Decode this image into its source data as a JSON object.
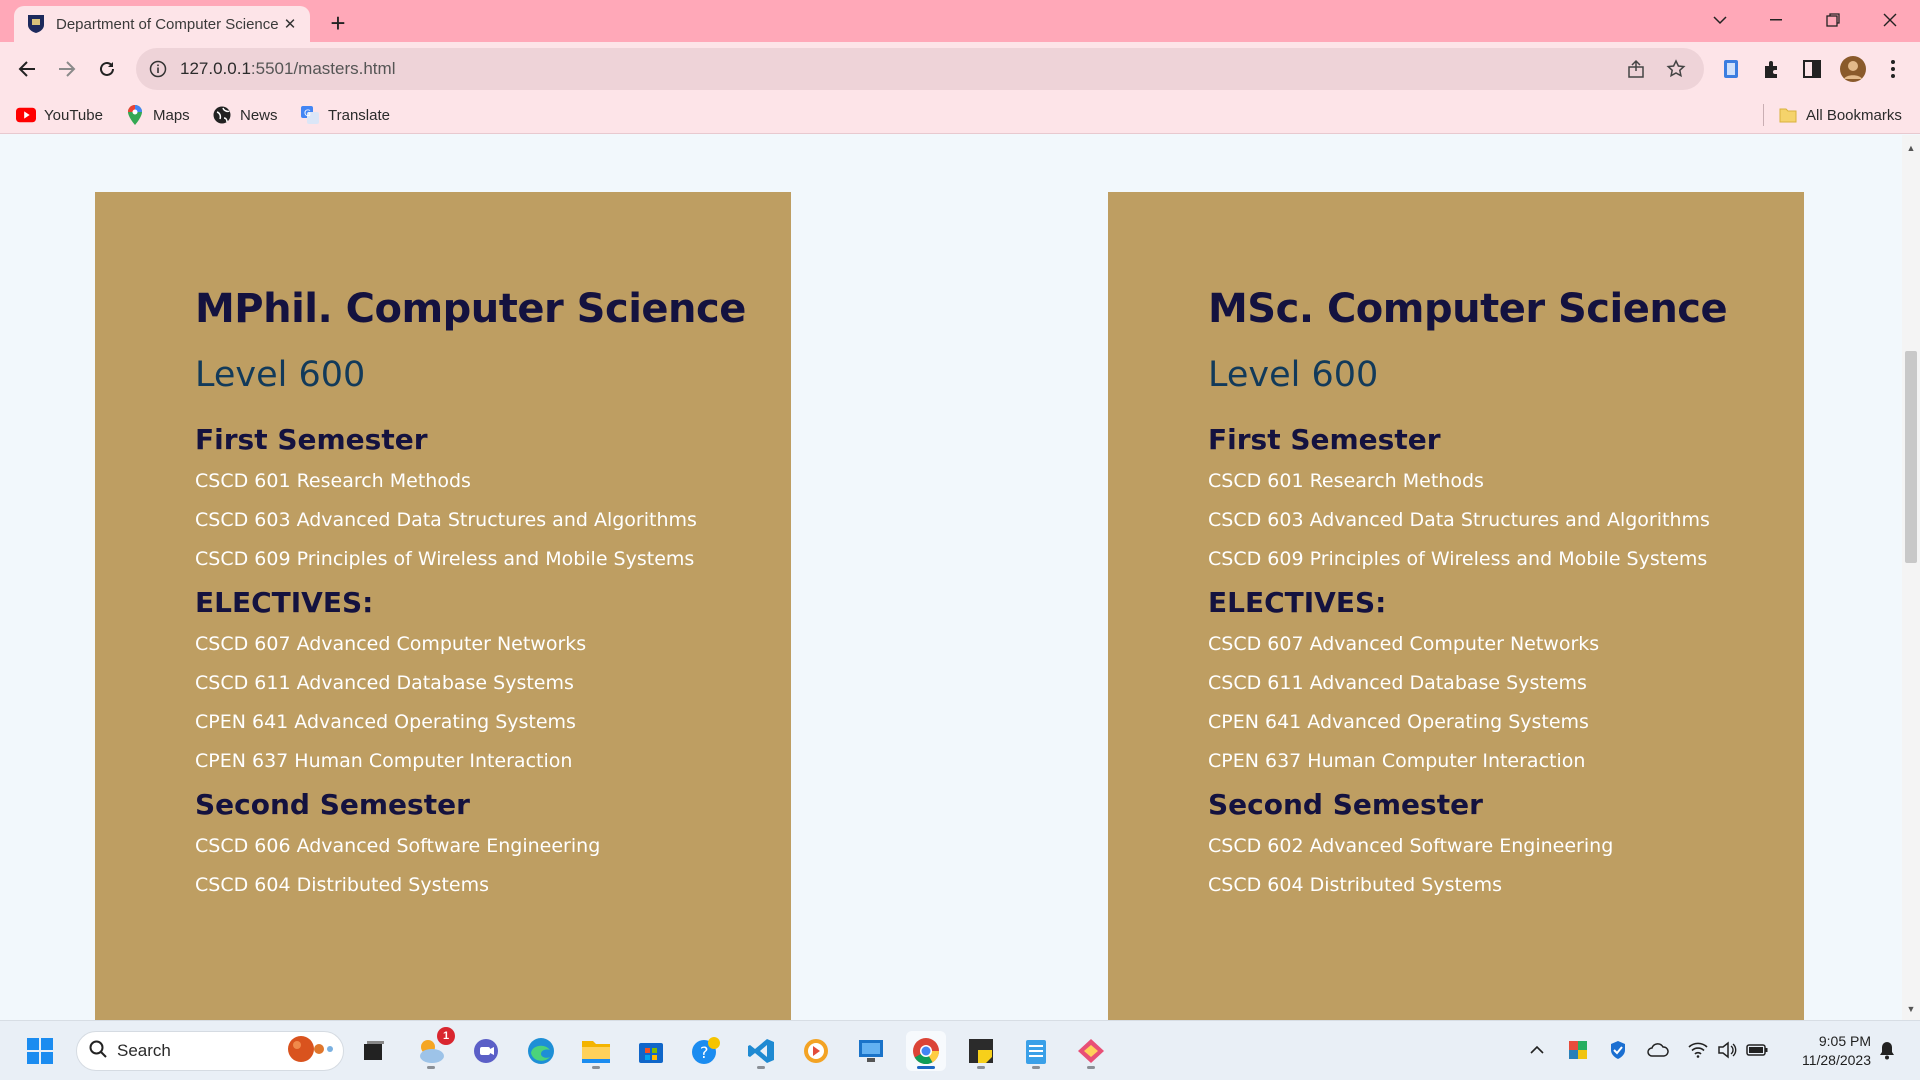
{
  "browser": {
    "tab_title": "Department of Computer Science",
    "url_host": "127.0.0.1",
    "url_rest": ":5501/masters.html",
    "bookmarks": [
      {
        "label": "YouTube",
        "icon": "youtube-icon"
      },
      {
        "label": "Maps",
        "icon": "maps-icon"
      },
      {
        "label": "News",
        "icon": "news-icon"
      },
      {
        "label": "Translate",
        "icon": "translate-icon"
      }
    ],
    "all_bookmarks": "All Bookmarks",
    "colors": {
      "titlebar": "#ffa8b8",
      "toolbar": "#fde4e8"
    }
  },
  "page": {
    "card_color": "#be9e62",
    "left": {
      "title": "MPhil. Computer Science",
      "level": "Level 600",
      "first_semester": "First Semester",
      "first_courses": [
        "CSCD 601 Research Methods",
        "CSCD 603 Advanced Data Structures and Algorithms",
        "CSCD 609 Principles of Wireless and Mobile Systems"
      ],
      "electives_heading": "ELECTIVES:",
      "electives": [
        "CSCD 607 Advanced Computer Networks",
        "CSCD 611 Advanced Database Systems",
        "CPEN 641 Advanced Operating Systems",
        "CPEN 637 Human Computer Interaction"
      ],
      "second_semester": "Second Semester",
      "second_courses": [
        "CSCD 606 Advanced Software Engineering",
        "CSCD 604 Distributed Systems"
      ]
    },
    "right": {
      "title": "MSc. Computer Science",
      "level": "Level 600",
      "first_semester": "First Semester",
      "first_courses": [
        "CSCD 601 Research Methods",
        "CSCD 603 Advanced Data Structures and Algorithms",
        "CSCD 609 Principles of Wireless and Mobile Systems"
      ],
      "electives_heading": "ELECTIVES:",
      "electives": [
        "CSCD 607 Advanced Computer Networks",
        "CSCD 611 Advanced Database Systems",
        "CPEN 641 Advanced Operating Systems",
        "CPEN 637 Human Computer Interaction"
      ],
      "second_semester": "Second Semester",
      "second_courses": [
        "CSCD 602 Advanced Software Engineering",
        "CSCD 604 Distributed Systems"
      ]
    }
  },
  "taskbar": {
    "search_label": "Search",
    "weather_badge": "1",
    "time": "9:05 PM",
    "date": "11/28/2023"
  }
}
